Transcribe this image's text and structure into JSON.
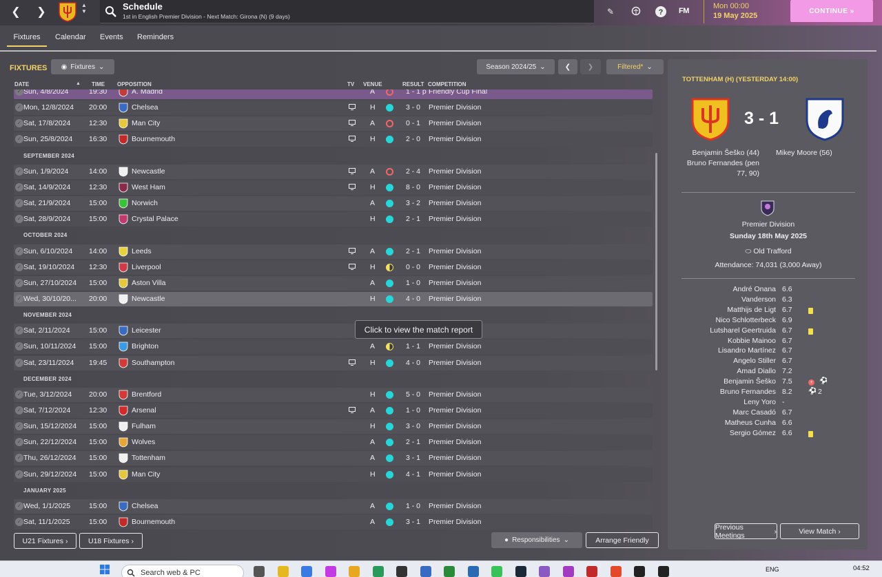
{
  "header": {
    "title": "Schedule",
    "subtitle": "1st in English Premier Division - Next Match: Girona (N) (9 days)",
    "time": "Mon 00:00",
    "date": "19 May 2025",
    "continue_label": "CONTINUE",
    "fm_label": "FM"
  },
  "tabs": [
    {
      "label": "Fixtures",
      "active": true
    },
    {
      "label": "Calendar"
    },
    {
      "label": "Events"
    },
    {
      "label": "Reminders"
    }
  ],
  "toolbar": {
    "section_label": "FIXTURES",
    "view_dropdown": "Fixtures",
    "season_dropdown": "Season 2024/25",
    "filter_label": "Filtered*"
  },
  "columns": {
    "date": "DATE",
    "time": "TIME",
    "opposition": "OPPOSITION",
    "tv": "TV",
    "venue": "VENUE",
    "result": "RESULT",
    "competition": "COMPETITION"
  },
  "fixtures": [
    {
      "date": "Sun, 4/8/2024",
      "time": "19:30",
      "opp": "A. Madrid",
      "tv": false,
      "venue": "A",
      "res": "L",
      "score": "1 - 1 p",
      "comp": "Friendly Cup Final",
      "color": "#c23a3a",
      "style": "purple"
    },
    {
      "date": "Mon, 12/8/2024",
      "time": "20:00",
      "opp": "Chelsea",
      "tv": true,
      "venue": "H",
      "res": "W",
      "score": "3 - 0",
      "comp": "Premier Division",
      "color": "#3a6bc2"
    },
    {
      "date": "Sat, 17/8/2024",
      "time": "12:30",
      "opp": "Man City",
      "tv": true,
      "venue": "A",
      "res": "L",
      "score": "0 - 1",
      "comp": "Premier Division",
      "color": "#e6c63a"
    },
    {
      "date": "Sun, 25/8/2024",
      "time": "16:30",
      "opp": "Bournemouth",
      "tv": true,
      "venue": "H",
      "res": "W",
      "score": "2 - 0",
      "comp": "Premier Division",
      "color": "#c22a2a"
    },
    {
      "month": "SEPTEMBER 2024"
    },
    {
      "date": "Sun, 1/9/2024",
      "time": "14:00",
      "opp": "Newcastle",
      "tv": true,
      "venue": "A",
      "res": "L",
      "score": "2 - 4",
      "comp": "Premier Division",
      "color": "#f0f0f0"
    },
    {
      "date": "Sat, 14/9/2024",
      "time": "12:30",
      "opp": "West Ham",
      "tv": true,
      "venue": "H",
      "res": "W",
      "score": "8 - 0",
      "comp": "Premier Division",
      "color": "#8a2a4a"
    },
    {
      "date": "Sat, 21/9/2024",
      "time": "15:00",
      "opp": "Norwich",
      "tv": false,
      "venue": "A",
      "res": "W",
      "score": "3 - 2",
      "comp": "Premier Division",
      "color": "#3ac23a"
    },
    {
      "date": "Sat, 28/9/2024",
      "time": "15:00",
      "opp": "Crystal Palace",
      "tv": false,
      "venue": "H",
      "res": "W",
      "score": "2 - 1",
      "comp": "Premier Division",
      "color": "#c23a6b"
    },
    {
      "month": "OCTOBER 2024"
    },
    {
      "date": "Sun, 6/10/2024",
      "time": "14:00",
      "opp": "Leeds",
      "tv": true,
      "venue": "A",
      "res": "W",
      "score": "2 - 1",
      "comp": "Premier Division",
      "color": "#e6d23a"
    },
    {
      "date": "Sat, 19/10/2024",
      "time": "12:30",
      "opp": "Liverpool",
      "tv": true,
      "venue": "H",
      "res": "D",
      "score": "0 - 0",
      "comp": "Premier Division",
      "color": "#d23a4a"
    },
    {
      "date": "Sun, 27/10/2024",
      "time": "15:00",
      "opp": "Aston Villa",
      "tv": false,
      "venue": "A",
      "res": "W",
      "score": "1 - 0",
      "comp": "Premier Division",
      "color": "#e6c63a"
    },
    {
      "date": "Wed, 30/10/20...",
      "time": "20:00",
      "opp": "Newcastle",
      "tv": false,
      "venue": "H",
      "res": "W",
      "score": "4 - 0",
      "comp": "Premier Division",
      "color": "#f0f0f0",
      "style": "selected"
    },
    {
      "month": "NOVEMBER 2024"
    },
    {
      "date": "Sat, 2/11/2024",
      "time": "15:00",
      "opp": "Leicester",
      "tv": false,
      "venue": "",
      "res": "",
      "score": "",
      "comp": "",
      "color": "#3a6bc2"
    },
    {
      "date": "Sun, 10/11/2024",
      "time": "15:00",
      "opp": "Brighton",
      "tv": false,
      "venue": "A",
      "res": "D",
      "score": "1 - 1",
      "comp": "Premier Division",
      "color": "#3a9ae6"
    },
    {
      "date": "Sat, 23/11/2024",
      "time": "19:45",
      "opp": "Southampton",
      "tv": true,
      "venue": "H",
      "res": "W",
      "score": "4 - 0",
      "comp": "Premier Division",
      "color": "#d23a3a"
    },
    {
      "month": "DECEMBER 2024"
    },
    {
      "date": "Tue, 3/12/2024",
      "time": "20:00",
      "opp": "Brentford",
      "tv": false,
      "venue": "H",
      "res": "W",
      "score": "5 - 0",
      "comp": "Premier Division",
      "color": "#d23a3a"
    },
    {
      "date": "Sat, 7/12/2024",
      "time": "12:30",
      "opp": "Arsenal",
      "tv": true,
      "venue": "A",
      "res": "W",
      "score": "1 - 0",
      "comp": "Premier Division",
      "color": "#d22a2a"
    },
    {
      "date": "Sun, 15/12/2024",
      "time": "15:00",
      "opp": "Fulham",
      "tv": false,
      "venue": "H",
      "res": "W",
      "score": "3 - 0",
      "comp": "Premier Division",
      "color": "#f0f0f0"
    },
    {
      "date": "Sun, 22/12/2024",
      "time": "15:00",
      "opp": "Wolves",
      "tv": false,
      "venue": "A",
      "res": "W",
      "score": "2 - 1",
      "comp": "Premier Division",
      "color": "#e6a63a"
    },
    {
      "date": "Thu, 26/12/2024",
      "time": "15:00",
      "opp": "Tottenham",
      "tv": false,
      "venue": "A",
      "res": "W",
      "score": "3 - 1",
      "comp": "Premier Division",
      "color": "#f0f0f0"
    },
    {
      "date": "Sun, 29/12/2024",
      "time": "15:00",
      "opp": "Man City",
      "tv": false,
      "venue": "H",
      "res": "W",
      "score": "4 - 1",
      "comp": "Premier Division",
      "color": "#e6c63a"
    },
    {
      "month": "JANUARY 2025"
    },
    {
      "date": "Wed, 1/1/2025",
      "time": "15:00",
      "opp": "Chelsea",
      "tv": false,
      "venue": "A",
      "res": "W",
      "score": "1 - 0",
      "comp": "Premier Division",
      "color": "#3a6bc2"
    },
    {
      "date": "Sat, 11/1/2025",
      "time": "15:00",
      "opp": "Bournemouth",
      "tv": false,
      "venue": "A",
      "res": "W",
      "score": "3 - 1",
      "comp": "Premier Division",
      "color": "#c22a2a"
    }
  ],
  "tooltip": "Click to view the match report",
  "bottom_buttons": {
    "u21": "U21 Fixtures",
    "u18": "U18 Fixtures",
    "responsibilities": "Responsibilities",
    "arrange": "Arrange Friendly"
  },
  "match_panel": {
    "title": "TOTTENHAM (H) (YESTERDAY 14:00)",
    "score": "3 - 1",
    "home_scorers": [
      "Benjamin Šeško (44)",
      "Bruno Fernandes (pen",
      "77, 90)"
    ],
    "away_scorers": [
      "Mikey Moore (56)"
    ],
    "competition": "Premier Division",
    "match_date": "Sunday 18th May 2025",
    "stadium": "Old Trafford",
    "attendance": "Attendance: 74,031 (3,000 Away)",
    "players": [
      {
        "name": "André Onana",
        "rating": "6.6"
      },
      {
        "name": "Vanderson",
        "rating": "6.3"
      },
      {
        "name": "Matthijs de Ligt",
        "rating": "6.7",
        "yellow": true
      },
      {
        "name": "Nico Schlotterbeck",
        "rating": "6.9"
      },
      {
        "name": "Lutsharel Geertruida",
        "rating": "6.7",
        "yellow": true
      },
      {
        "name": "Kobbie Mainoo",
        "rating": "6.7"
      },
      {
        "name": "Lisandro Martínez",
        "rating": "6.7"
      },
      {
        "name": "Angelo Stiller",
        "rating": "6.7"
      },
      {
        "name": "Amad Diallo",
        "rating": "7.2"
      },
      {
        "name": "Benjamin Šeško",
        "rating": "7.5",
        "assist": true,
        "goal": true
      },
      {
        "name": "Bruno Fernandes",
        "rating": "8.2",
        "goal": true,
        "goals": "2"
      },
      {
        "name": "Leny Yoro",
        "rating": "-"
      },
      {
        "name": "Marc Casadó",
        "rating": "6.7"
      },
      {
        "name": "Matheus Cunha",
        "rating": "6.6"
      },
      {
        "name": "Sergio Gómez",
        "rating": "6.6",
        "yellow": true
      }
    ],
    "prev_meetings": "Previous Meetings",
    "view_match": "View Match"
  },
  "taskbar": {
    "search_placeholder": "Search web & PC",
    "lang": "ENG",
    "time": "04:52"
  }
}
